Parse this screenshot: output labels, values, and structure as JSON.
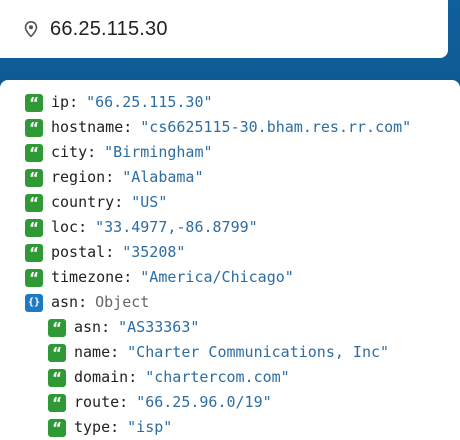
{
  "search": {
    "value": "66.25.115.30",
    "icon": "map-pin-icon"
  },
  "result": {
    "top": [
      {
        "key": "ip",
        "value": "\"66.25.115.30\"",
        "icon": "quote-icon"
      },
      {
        "key": "hostname",
        "value": "\"cs6625115-30.bham.res.rr.com\"",
        "icon": "quote-icon"
      },
      {
        "key": "city",
        "value": "\"Birmingham\"",
        "icon": "quote-icon"
      },
      {
        "key": "region",
        "value": "\"Alabama\"",
        "icon": "quote-icon"
      },
      {
        "key": "country",
        "value": "\"US\"",
        "icon": "quote-icon"
      },
      {
        "key": "loc",
        "value": "\"33.4977,-86.8799\"",
        "icon": "quote-icon"
      },
      {
        "key": "postal",
        "value": "\"35208\"",
        "icon": "quote-icon"
      },
      {
        "key": "timezone",
        "value": "\"America/Chicago\"",
        "icon": "quote-icon"
      },
      {
        "key": "asn",
        "value": "Object",
        "icon": "object-icon"
      }
    ],
    "asn_children": [
      {
        "key": "asn",
        "value": "\"AS33363\"",
        "icon": "quote-icon"
      },
      {
        "key": "name",
        "value": "\"Charter Communications, Inc\"",
        "icon": "quote-icon"
      },
      {
        "key": "domain",
        "value": "\"chartercom.com\"",
        "icon": "quote-icon"
      },
      {
        "key": "route",
        "value": "\"66.25.96.0/19\"",
        "icon": "quote-icon"
      },
      {
        "key": "type",
        "value": "\"isp\"",
        "icon": "quote-icon"
      }
    ]
  }
}
